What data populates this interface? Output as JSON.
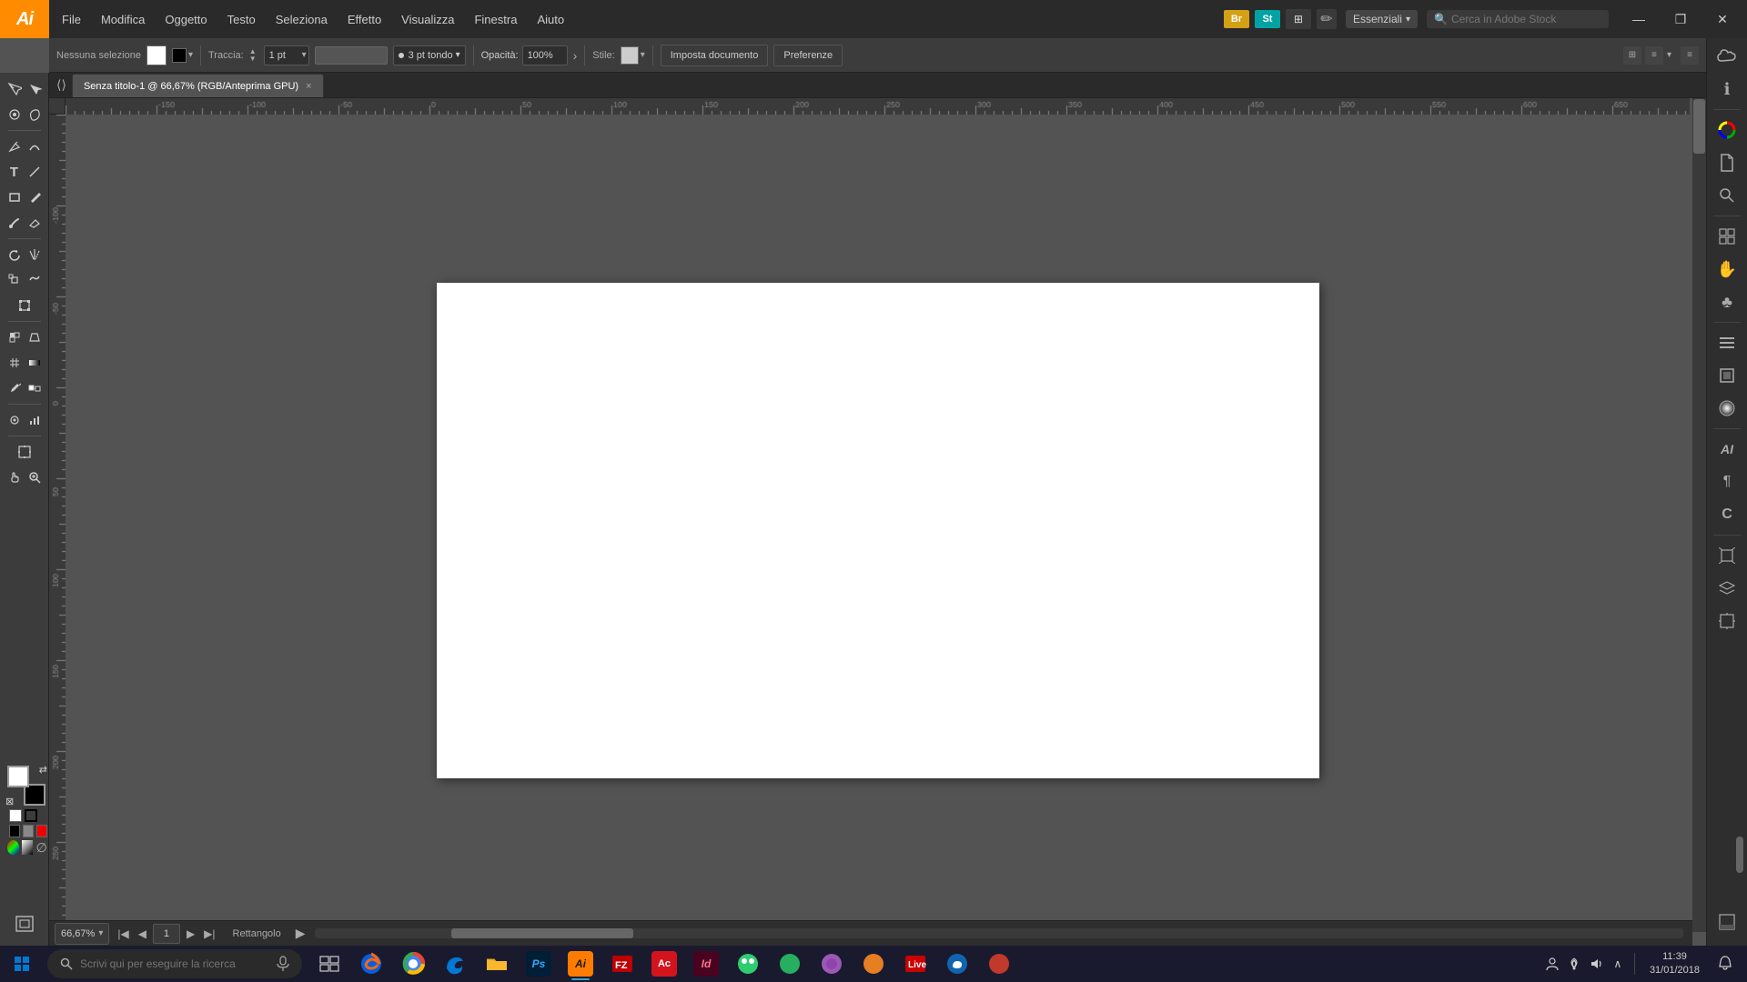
{
  "app": {
    "logo": "Ai",
    "title": "Adobe Illustrator"
  },
  "title_bar": {
    "menu_items": [
      "File",
      "Modifica",
      "Oggetto",
      "Testo",
      "Seleziona",
      "Effetto",
      "Visualizza",
      "Finestra",
      "Aiuto"
    ],
    "cc_badges": [
      {
        "label": "Br",
        "class": "cc-badge-br"
      },
      {
        "label": "St",
        "class": "cc-badge-st"
      }
    ],
    "workspace_label": "Essenziali",
    "search_placeholder": "Cerca in Adobe Stock",
    "win_controls": [
      "—",
      "❐",
      "✕"
    ]
  },
  "control_bar": {
    "selection_label": "Nessuna selezione",
    "fill_swatch_color": "#ffffff",
    "stroke_swatch_color": "#000000",
    "stroke_label": "Traccia:",
    "stroke_value": "1 pt",
    "stroke_style_label": "3 pt tondo",
    "opacity_label": "Opacità:",
    "opacity_value": "100%",
    "style_label": "Stile:",
    "doc_setup_btn": "Imposta documento",
    "prefs_btn": "Preferenze",
    "align_icons": [
      "⊞",
      "≡"
    ]
  },
  "tab": {
    "title": "Senza titolo-1 @ 66,67% (RGB/Anteprima GPU)",
    "close": "×"
  },
  "status_bar": {
    "zoom_value": "66,67%",
    "page_number": "1",
    "tool_name": "Rettangolo",
    "nav_arrow": "▶"
  },
  "left_tools": [
    {
      "icon": "↖",
      "name": "select-tool"
    },
    {
      "icon": "↗",
      "name": "direct-select-tool"
    },
    {
      "icon": "⟳",
      "name": "magic-wand-tool"
    },
    {
      "icon": "⬡",
      "name": "lasso-tool"
    },
    {
      "icon": "✎",
      "name": "pen-tool"
    },
    {
      "icon": "✏",
      "name": "curvature-tool"
    },
    {
      "icon": "T",
      "name": "text-tool"
    },
    {
      "icon": "/",
      "name": "line-tool"
    },
    {
      "icon": "□",
      "name": "rect-tool"
    },
    {
      "icon": "✎",
      "name": "pencil-tool"
    },
    {
      "icon": "⌀",
      "name": "blob-brush-tool"
    },
    {
      "icon": "✂",
      "name": "eraser-tool"
    },
    {
      "icon": "⤡",
      "name": "rotate-tool"
    },
    {
      "icon": "⟳",
      "name": "reflect-tool"
    },
    {
      "icon": "◈",
      "name": "scale-tool"
    },
    {
      "icon": "⌇",
      "name": "warp-tool"
    },
    {
      "icon": "⬜",
      "name": "free-transform-tool"
    },
    {
      "icon": "⬡",
      "name": "shape-builder-tool"
    },
    {
      "icon": "☀",
      "name": "live-paint-tool"
    },
    {
      "icon": "⊞",
      "name": "perspective-tool"
    },
    {
      "icon": "≋",
      "name": "mesh-tool"
    },
    {
      "icon": "◈",
      "name": "gradient-tool"
    },
    {
      "icon": "✎",
      "name": "eyedropper-tool"
    },
    {
      "icon": "⬛",
      "name": "blend-tool"
    },
    {
      "icon": "⊞",
      "name": "symbol-tool"
    },
    {
      "icon": "◫",
      "name": "column-graph-tool"
    },
    {
      "icon": "☞",
      "name": "artboard-tool"
    },
    {
      "icon": "✋",
      "name": "hand-tool"
    },
    {
      "icon": "🔍",
      "name": "zoom-tool"
    }
  ],
  "right_panel_icons": [
    "☁",
    "ℹ",
    "🎨",
    "📄",
    "🔍",
    "⊞",
    "✋",
    "♣",
    "≡",
    "▣",
    "●",
    "AI",
    "¶",
    "C",
    "⬡",
    "🔲",
    "◫"
  ],
  "color_area": {
    "fg": "#ffffff",
    "bg": "#000000"
  },
  "taskbar": {
    "search_placeholder": "Scrivi qui per eseguire la ricerca",
    "apps": [
      {
        "icon": "⊞",
        "name": "windows-start",
        "color": "#0078d4"
      },
      {
        "icon": "🦊",
        "name": "firefox",
        "color": "#ff6611"
      },
      {
        "icon": "●",
        "name": "chrome",
        "color": "#4285f4"
      },
      {
        "icon": "e",
        "name": "edge",
        "color": "#0078d4"
      },
      {
        "icon": "📁",
        "name": "explorer",
        "color": "#f9b82f"
      },
      {
        "icon": "Ps",
        "name": "photoshop",
        "color": "#001e36"
      },
      {
        "icon": "Ai",
        "name": "illustrator",
        "color": "#ff7c00"
      },
      {
        "icon": "FZ",
        "name": "filezilla",
        "color": "#bf0000"
      },
      {
        "icon": "Ac",
        "name": "acrobat",
        "color": "#d4141c"
      },
      {
        "icon": "Id",
        "name": "indesign",
        "color": "#49021f"
      },
      {
        "icon": "●",
        "name": "app1",
        "color": "#2ecc71"
      },
      {
        "icon": "●",
        "name": "app2",
        "color": "#27ae60"
      },
      {
        "icon": "◯",
        "name": "app3",
        "color": "#9b59b6"
      },
      {
        "icon": "★",
        "name": "app4",
        "color": "#e67e22"
      },
      {
        "icon": "📺",
        "name": "app5",
        "color": "#e74c3c"
      },
      {
        "icon": "S",
        "name": "skype",
        "color": "#00aff0"
      },
      {
        "icon": "●",
        "name": "app6",
        "color": "#c0392b"
      }
    ],
    "clock": {
      "time": "11:39",
      "date": "31/01/2018"
    }
  }
}
